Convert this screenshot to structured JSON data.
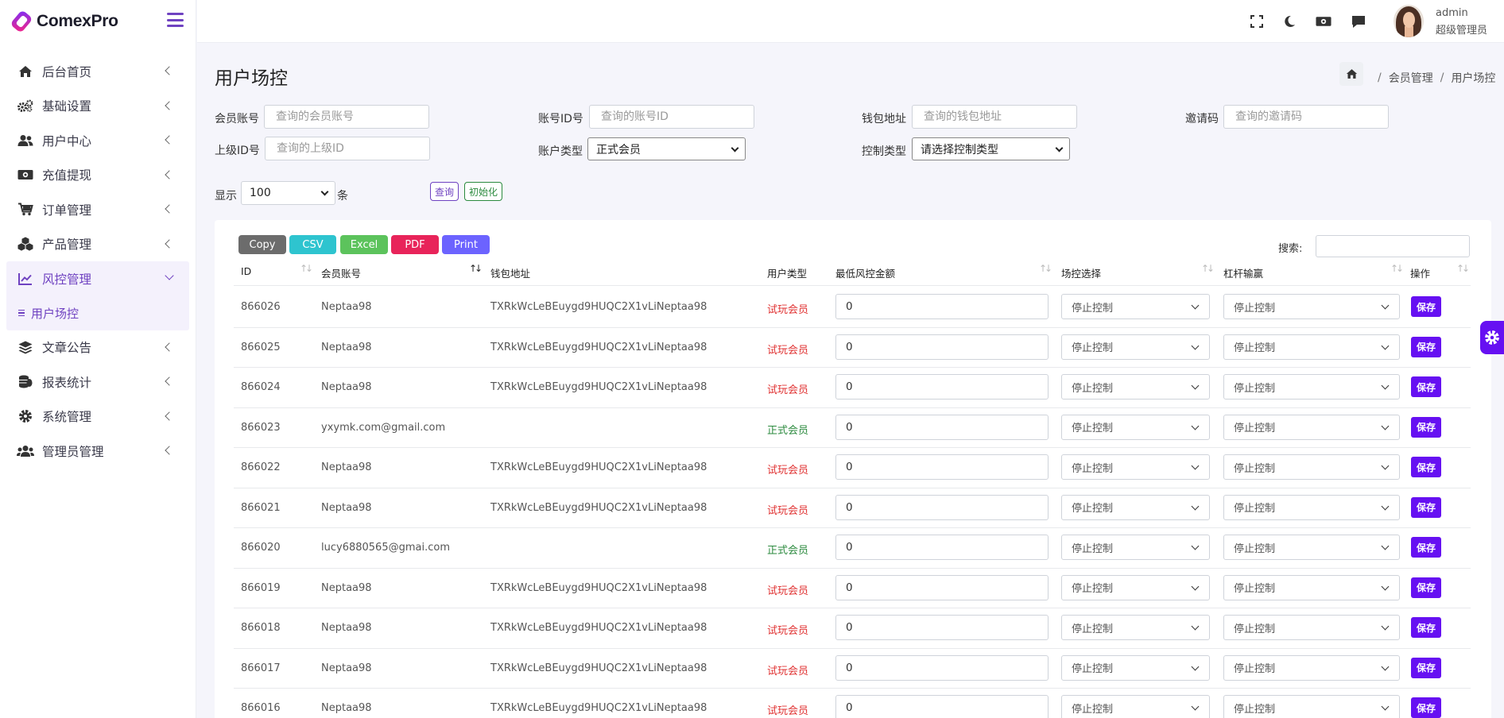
{
  "app": {
    "brand": "ComexPro"
  },
  "sidebar": {
    "items": [
      {
        "label": "后台首页",
        "icon": "home-icon"
      },
      {
        "label": "基础设置",
        "icon": "gears-icon"
      },
      {
        "label": "用户中心",
        "icon": "users-icon"
      },
      {
        "label": "充值提现",
        "icon": "money-icon"
      },
      {
        "label": "订单管理",
        "icon": "cart-icon"
      },
      {
        "label": "产品管理",
        "icon": "cubes-icon"
      },
      {
        "label": "风控管理",
        "icon": "chart-line-icon",
        "active": true,
        "expanded": true
      },
      {
        "label": "文章公告",
        "icon": "layers-icon"
      },
      {
        "label": "报表统计",
        "icon": "coins-icon"
      },
      {
        "label": "系统管理",
        "icon": "gear-icon"
      },
      {
        "label": "管理员管理",
        "icon": "user-group-icon"
      }
    ],
    "submenu": {
      "label": "用户场控",
      "active": true
    }
  },
  "header": {
    "user": {
      "name": "admin",
      "role": "超级管理员"
    },
    "icons": [
      "fullscreen-icon",
      "moon-icon",
      "money-icon",
      "chat-icon"
    ]
  },
  "page": {
    "title": "用户场控",
    "breadcrumb": [
      "会员管理",
      "用户场控"
    ]
  },
  "filters": {
    "member_account": {
      "label": "会员账号",
      "placeholder": "查询的会员账号"
    },
    "account_id": {
      "label": "账号ID号",
      "placeholder": "查询的账号ID"
    },
    "wallet": {
      "label": "钱包地址",
      "placeholder": "查询的钱包地址"
    },
    "invite": {
      "label": "邀请码",
      "placeholder": "查询的邀请码"
    },
    "parent_id": {
      "label": "上级ID号",
      "placeholder": "查询的上级ID"
    },
    "account_type": {
      "label": "账户类型",
      "value": "正式会员"
    },
    "control_type": {
      "label": "控制类型",
      "value": "请选择控制类型"
    },
    "show_label": "显示",
    "page_size": "100",
    "unit": "条",
    "query_label": "查询",
    "reset_label": "初始化"
  },
  "colors": {
    "accent": "#6f42c1",
    "save": "#6610f2",
    "trial": "#e03131",
    "formal": "#2b8a3e",
    "copy": "#6c6c6c",
    "csv": "#2ec4cf",
    "excel": "#5cc35c",
    "pdf": "#e8245a",
    "print": "#6c63ff"
  },
  "table": {
    "export_buttons": [
      "Copy",
      "CSV",
      "Excel",
      "PDF",
      "Print"
    ],
    "search_label": "搜索:",
    "columns": [
      "ID",
      "会员账号",
      "钱包地址",
      "用户类型",
      "最低风控金额",
      "场控选择",
      "杠杆输赢",
      "操作"
    ],
    "rows": [
      {
        "id": "866026",
        "account": "Neptaa98",
        "wallet": "TXRkWcLeBEuygd9HUQC2X1vLiNeptaa98",
        "type": "试玩会员",
        "amount": "0",
        "control": "停止控制",
        "leverage": "停止控制",
        "action": "保存"
      },
      {
        "id": "866025",
        "account": "Neptaa98",
        "wallet": "TXRkWcLeBEuygd9HUQC2X1vLiNeptaa98",
        "type": "试玩会员",
        "amount": "0",
        "control": "停止控制",
        "leverage": "停止控制",
        "action": "保存"
      },
      {
        "id": "866024",
        "account": "Neptaa98",
        "wallet": "TXRkWcLeBEuygd9HUQC2X1vLiNeptaa98",
        "type": "试玩会员",
        "amount": "0",
        "control": "停止控制",
        "leverage": "停止控制",
        "action": "保存"
      },
      {
        "id": "866023",
        "account": "yxymk.com@gmail.com",
        "wallet": "",
        "type": "正式会员",
        "amount": "0",
        "control": "停止控制",
        "leverage": "停止控制",
        "action": "保存"
      },
      {
        "id": "866022",
        "account": "Neptaa98",
        "wallet": "TXRkWcLeBEuygd9HUQC2X1vLiNeptaa98",
        "type": "试玩会员",
        "amount": "0",
        "control": "停止控制",
        "leverage": "停止控制",
        "action": "保存"
      },
      {
        "id": "866021",
        "account": "Neptaa98",
        "wallet": "TXRkWcLeBEuygd9HUQC2X1vLiNeptaa98",
        "type": "试玩会员",
        "amount": "0",
        "control": "停止控制",
        "leverage": "停止控制",
        "action": "保存"
      },
      {
        "id": "866020",
        "account": "lucy6880565@gmai.com",
        "wallet": "",
        "type": "正式会员",
        "amount": "0",
        "control": "停止控制",
        "leverage": "停止控制",
        "action": "保存"
      },
      {
        "id": "866019",
        "account": "Neptaa98",
        "wallet": "TXRkWcLeBEuygd9HUQC2X1vLiNeptaa98",
        "type": "试玩会员",
        "amount": "0",
        "control": "停止控制",
        "leverage": "停止控制",
        "action": "保存"
      },
      {
        "id": "866018",
        "account": "Neptaa98",
        "wallet": "TXRkWcLeBEuygd9HUQC2X1vLiNeptaa98",
        "type": "试玩会员",
        "amount": "0",
        "control": "停止控制",
        "leverage": "停止控制",
        "action": "保存"
      },
      {
        "id": "866017",
        "account": "Neptaa98",
        "wallet": "TXRkWcLeBEuygd9HUQC2X1vLiNeptaa98",
        "type": "试玩会员",
        "amount": "0",
        "control": "停止控制",
        "leverage": "停止控制",
        "action": "保存"
      },
      {
        "id": "866016",
        "account": "Neptaa98",
        "wallet": "TXRkWcLeBEuygd9HUQC2X1vLiNeptaa98",
        "type": "试玩会员",
        "amount": "0",
        "control": "停止控制",
        "leverage": "停止控制",
        "action": "保存"
      }
    ]
  }
}
